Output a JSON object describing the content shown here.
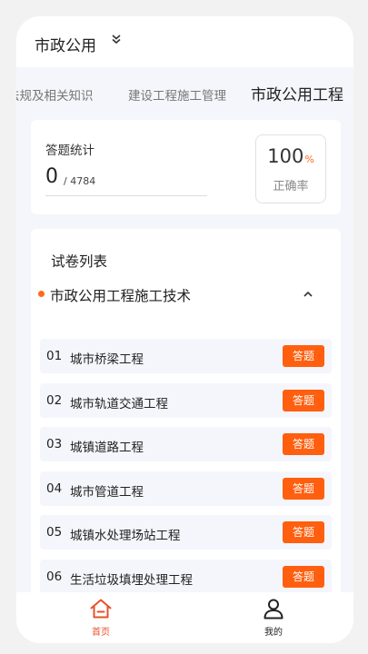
{
  "header": {
    "city": "市政公用"
  },
  "tabs": [
    {
      "label": "法规及相关知识"
    },
    {
      "label": "建设工程施工管理"
    },
    {
      "label": "市政公用工程"
    }
  ],
  "stats": {
    "label": "答题统计",
    "answered": "0",
    "total": "/ 4784",
    "rate_value": "100",
    "rate_unit": "%",
    "rate_label": "正确率"
  },
  "paper_list": {
    "title": "试卷列表",
    "section_title": "市政公用工程施工技术",
    "answer_label": "答题",
    "items": [
      {
        "no": "01",
        "name": "城市桥梁工程"
      },
      {
        "no": "02",
        "name": "城市轨道交通工程"
      },
      {
        "no": "03",
        "name": "城镇道路工程"
      },
      {
        "no": "04",
        "name": "城市管道工程"
      },
      {
        "no": "05",
        "name": "城镇水处理场站工程"
      },
      {
        "no": "06",
        "name": "生活垃圾填埋处理工程"
      }
    ]
  },
  "bottom_nav": {
    "home_label": "首页",
    "mine_label": "我的"
  },
  "colors": {
    "accent": "#ff5f0f",
    "active_nav": "#e8502b",
    "background": "#f4f6fb"
  },
  "icons": {
    "city_toggle": "chevron-down-icon",
    "collapse": "chevron-up-icon",
    "home": "home-icon",
    "mine": "user-icon"
  }
}
